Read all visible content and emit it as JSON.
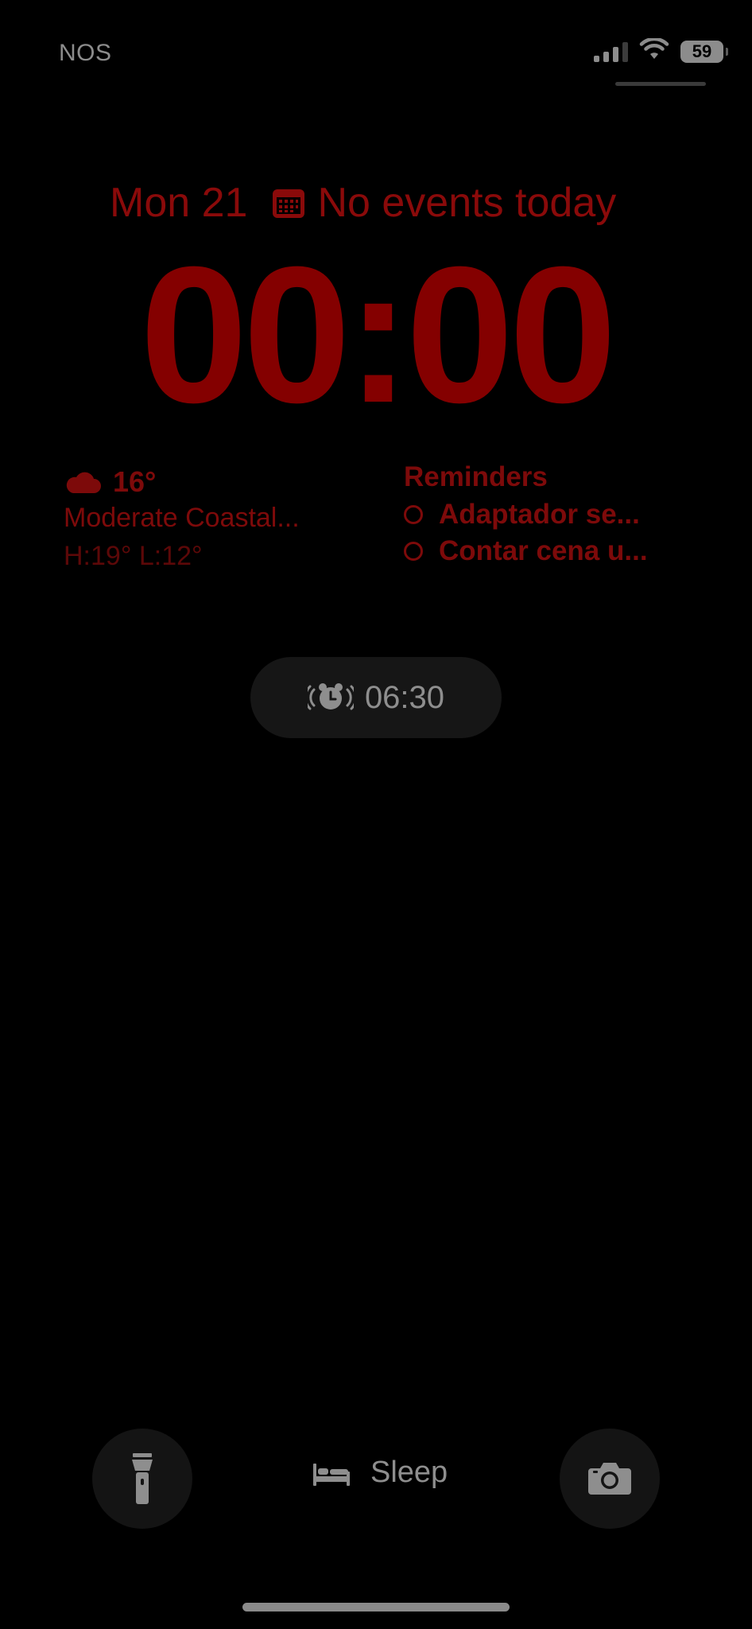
{
  "status_bar": {
    "carrier": "NOS",
    "battery_level": "59",
    "signal_bars": 3,
    "signal_bars_total": 4
  },
  "lock_screen": {
    "date": "Mon 21",
    "calendar_status": "No events today",
    "time": "00:00"
  },
  "weather": {
    "temperature": "16°",
    "condition": "Moderate Coastal...",
    "high_low": "H:19° L:12°"
  },
  "reminders": {
    "title": "Reminders",
    "items": [
      {
        "label": "Adaptador se..."
      },
      {
        "label": "Contar cena u..."
      }
    ]
  },
  "alarm": {
    "time": "06:30"
  },
  "controls": {
    "sleep_label": "Sleep"
  },
  "icons": {
    "flashlight": "flashlight-icon",
    "camera": "camera-icon",
    "bed": "bed-icon",
    "alarm": "alarm-clock-icon",
    "cloud": "cloud-icon",
    "calendar": "calendar-icon",
    "wifi": "wifi-icon"
  },
  "colors": {
    "accent_red": "#840000",
    "background": "#000000",
    "gray_text": "#8c8c8c"
  }
}
